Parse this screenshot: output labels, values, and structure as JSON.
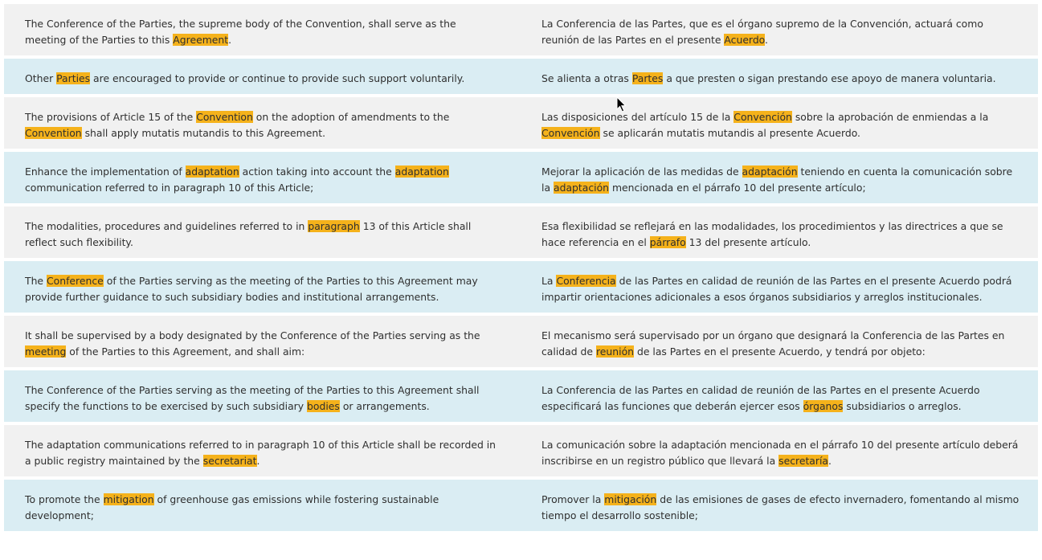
{
  "highlight_color": "#f5b21b",
  "row_colors": {
    "odd": "#f1f1f1",
    "even": "#daedf3"
  },
  "rows": [
    {
      "en": [
        [
          "The Conference of the Parties, the supreme body of the Convention, shall serve as the meeting of the Parties to this ",
          false
        ],
        [
          "Agreement",
          true
        ],
        [
          ".",
          false
        ]
      ],
      "es": [
        [
          "La Conferencia de las Partes, que es el órgano supremo de la Convención, actuará como reunión de las Partes en el presente ",
          false
        ],
        [
          "Acuerdo",
          true
        ],
        [
          ".",
          false
        ]
      ]
    },
    {
      "en": [
        [
          "Other ",
          false
        ],
        [
          "Parties",
          true
        ],
        [
          " are encouraged to provide or continue to provide such support voluntarily.",
          false
        ]
      ],
      "es": [
        [
          "Se alienta a otras ",
          false
        ],
        [
          "Partes",
          true
        ],
        [
          " a que presten o sigan prestando ese apoyo de manera voluntaria.",
          false
        ]
      ]
    },
    {
      "en": [
        [
          "The provisions of Article 15 of the ",
          false
        ],
        [
          "Convention",
          true
        ],
        [
          " on the adoption of amendments to the ",
          false
        ],
        [
          "Convention",
          true
        ],
        [
          " shall apply mutatis mutandis to this Agreement.",
          false
        ]
      ],
      "es": [
        [
          "Las disposiciones del artículo 15 de la ",
          false
        ],
        [
          "Convención",
          true
        ],
        [
          " sobre la aprobación de enmiendas a la ",
          false
        ],
        [
          "Convención",
          true
        ],
        [
          " se aplicarán mutatis mutandis al presente Acuerdo.",
          false
        ]
      ]
    },
    {
      "en": [
        [
          "Enhance the implementation of ",
          false
        ],
        [
          "adaptation",
          true
        ],
        [
          " action taking into account the ",
          false
        ],
        [
          "adaptation",
          true
        ],
        [
          " communication referred to in paragraph 10 of this Article;",
          false
        ]
      ],
      "es": [
        [
          "Mejorar la aplicación de las medidas de ",
          false
        ],
        [
          "adaptación",
          true
        ],
        [
          " teniendo en cuenta la comunicación sobre la ",
          false
        ],
        [
          "adaptación",
          true
        ],
        [
          " mencionada en el párrafo 10 del presente artículo;",
          false
        ]
      ]
    },
    {
      "en": [
        [
          "The modalities, procedures and guidelines referred to in ",
          false
        ],
        [
          "paragraph",
          true
        ],
        [
          " 13 of this Article shall reflect such flexibility.",
          false
        ]
      ],
      "es": [
        [
          "Esa flexibilidad se reflejará en las modalidades, los procedimientos y las directrices a que se hace referencia en el ",
          false
        ],
        [
          "párrafo",
          true
        ],
        [
          " 13 del presente artículo.",
          false
        ]
      ]
    },
    {
      "en": [
        [
          "The ",
          false
        ],
        [
          "Conference",
          true
        ],
        [
          " of the Parties serving as the meeting of the Parties to this Agreement may provide further guidance to such subsidiary bodies and institutional arrangements.",
          false
        ]
      ],
      "es": [
        [
          "La ",
          false
        ],
        [
          "Conferencia",
          true
        ],
        [
          " de las Partes en calidad de reunión de las Partes en el presente Acuerdo podrá impartir orientaciones adicionales a esos órganos subsidiarios y arreglos institucionales.",
          false
        ]
      ]
    },
    {
      "en": [
        [
          "It shall be supervised by a body designated by the Conference of the Parties serving as the ",
          false
        ],
        [
          "meeting",
          true
        ],
        [
          " of the Parties to this Agreement, and shall aim:",
          false
        ]
      ],
      "es": [
        [
          "El mecanismo será supervisado por un órgano que designará la Conferencia de las Partes en calidad de ",
          false
        ],
        [
          "reunión",
          true
        ],
        [
          " de las Partes en el presente Acuerdo, y tendrá por objeto:",
          false
        ]
      ]
    },
    {
      "en": [
        [
          "The Conference of the Parties serving as the meeting of the Parties to this Agreement shall specify the functions to be exercised by such subsidiary ",
          false
        ],
        [
          "bodies",
          true
        ],
        [
          " or arrangements.",
          false
        ]
      ],
      "es": [
        [
          "La Conferencia de las Partes en calidad de reunión de las Partes en el presente Acuerdo especificará las funciones que deberán ejercer esos ",
          false
        ],
        [
          "órganos",
          true
        ],
        [
          " subsidiarios o arreglos.",
          false
        ]
      ]
    },
    {
      "en": [
        [
          "The adaptation communications referred to in paragraph 10 of this Article shall be recorded in a public registry maintained by the ",
          false
        ],
        [
          "secretariat",
          true
        ],
        [
          ".",
          false
        ]
      ],
      "es": [
        [
          "La comunicación sobre la adaptación mencionada en el párrafo 10 del presente artículo deberá inscribirse en un registro público que llevará la ",
          false
        ],
        [
          "secretaría",
          true
        ],
        [
          ".",
          false
        ]
      ]
    },
    {
      "en": [
        [
          "To promote the ",
          false
        ],
        [
          "mitigation",
          true
        ],
        [
          " of greenhouse gas emissions while fostering sustainable development;",
          false
        ]
      ],
      "es": [
        [
          "Promover la ",
          false
        ],
        [
          "mitigación",
          true
        ],
        [
          " de las emisiones de gases de efecto invernadero, fomentando al mismo tiempo el desarrollo sostenible;",
          false
        ]
      ]
    }
  ],
  "cursor": {
    "icon": "mouse-pointer-icon"
  }
}
